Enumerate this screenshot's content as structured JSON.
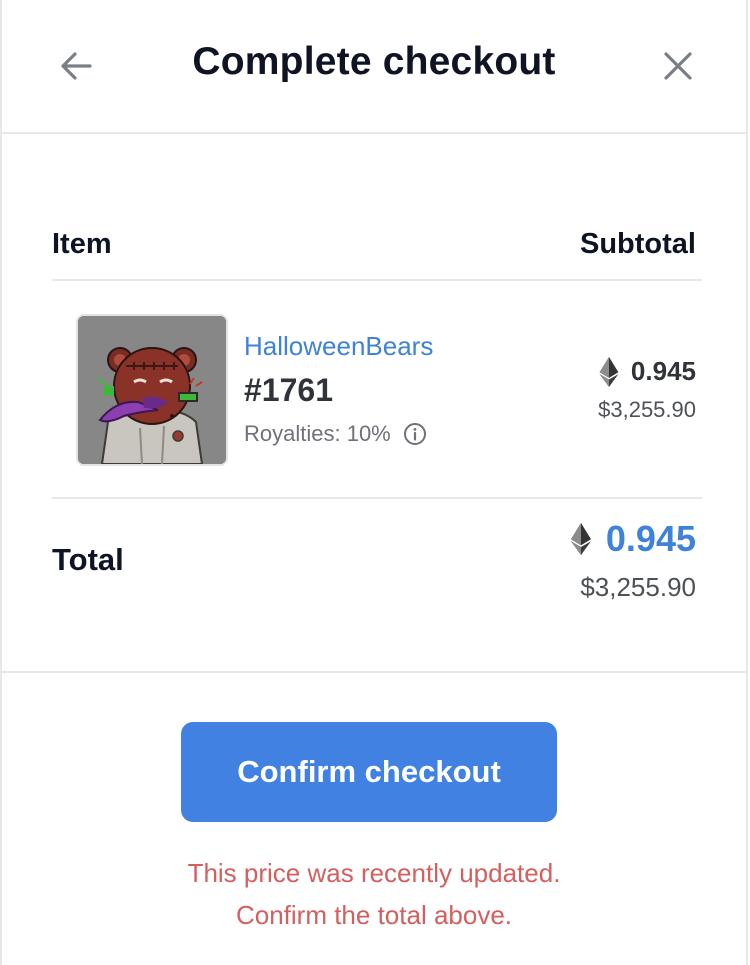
{
  "header": {
    "title": "Complete checkout",
    "back_icon": "arrow-left-icon",
    "close_icon": "close-icon"
  },
  "table": {
    "item_header": "Item",
    "subtotal_header": "Subtotal"
  },
  "item": {
    "collection": "HalloweenBears",
    "token_id": "#1761",
    "royalties": "Royalties: 10%",
    "price_eth": "0.945",
    "price_usd": "$3,255.90",
    "currency_icon": "ethereum-icon",
    "info_icon": "info-icon"
  },
  "total": {
    "label": "Total",
    "price_eth": "0.945",
    "price_usd": "$3,255.90"
  },
  "actions": {
    "confirm_label": "Confirm checkout"
  },
  "warning": {
    "line1": "This price was recently updated.",
    "line2": "Confirm the total above."
  },
  "colors": {
    "accent": "#4081e2",
    "link": "#3f82da",
    "warning": "#d35f5f",
    "divider": "#e6e8eb"
  }
}
